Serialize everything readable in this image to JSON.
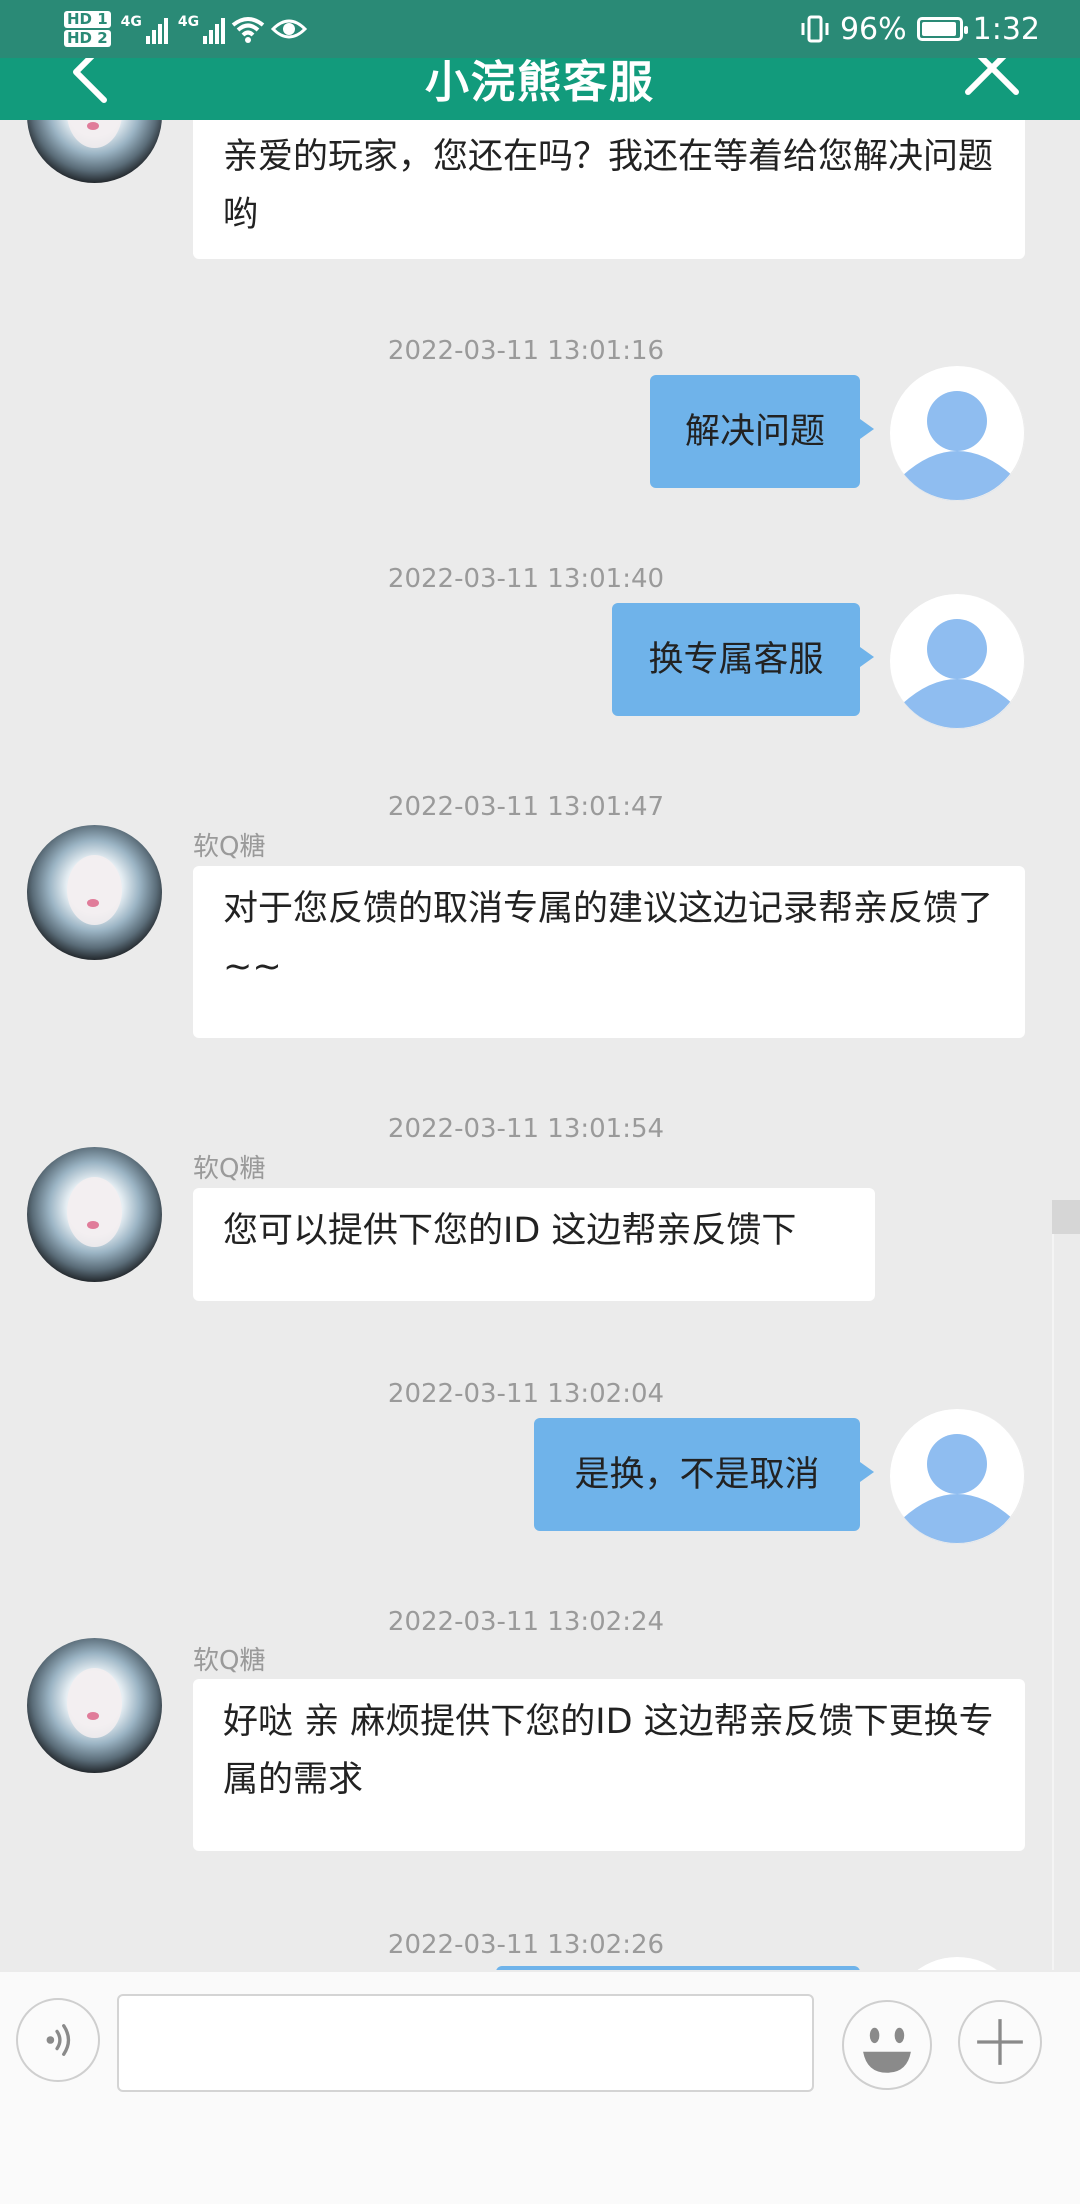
{
  "status_bar": {
    "hd1": "HD 1",
    "hd2": "HD 2",
    "net1": "4G",
    "net2": "4G",
    "battery_pct": "96%",
    "time": "1:32"
  },
  "header": {
    "title": "小浣熊客服"
  },
  "messages": [
    {
      "side": "left",
      "text": "亲爱的玩家，您还在吗？我还在等着给您解决问题哟"
    },
    {
      "side": "right",
      "time": "2022-03-11 13:01:16",
      "text": "解决问题"
    },
    {
      "side": "right",
      "time": "2022-03-11 13:01:40",
      "text": "换专属客服"
    },
    {
      "side": "left",
      "time": "2022-03-11 13:01:47",
      "sender": "软Q糖",
      "text": "对于您反馈的取消专属的建议这边记录帮亲反馈了~~"
    },
    {
      "side": "left",
      "time": "2022-03-11 13:01:54",
      "sender": "软Q糖",
      "text": "您可以提供下您的ID 这边帮亲反馈下"
    },
    {
      "side": "right",
      "time": "2022-03-11 13:02:04",
      "text": "是换，不是取消"
    },
    {
      "side": "left",
      "time": "2022-03-11 13:02:24",
      "sender": "软Q糖",
      "text": "好哒 亲 麻烦提供下您的ID 这边帮亲反馈下更换专属的需求"
    },
    {
      "side": "right",
      "time": "2022-03-11 13:02:26",
      "text": ""
    }
  ],
  "input": {
    "placeholder": ""
  },
  "colors": {
    "title_bar": "#129b7c",
    "status_bar": "#2a8a76",
    "bubble_right": "#6fb3ea",
    "background": "#ebebeb"
  },
  "icons": [
    "back-arrow-icon",
    "close-icon",
    "voice-icon",
    "emoji-icon",
    "plus-icon",
    "user-avatar-icon"
  ]
}
